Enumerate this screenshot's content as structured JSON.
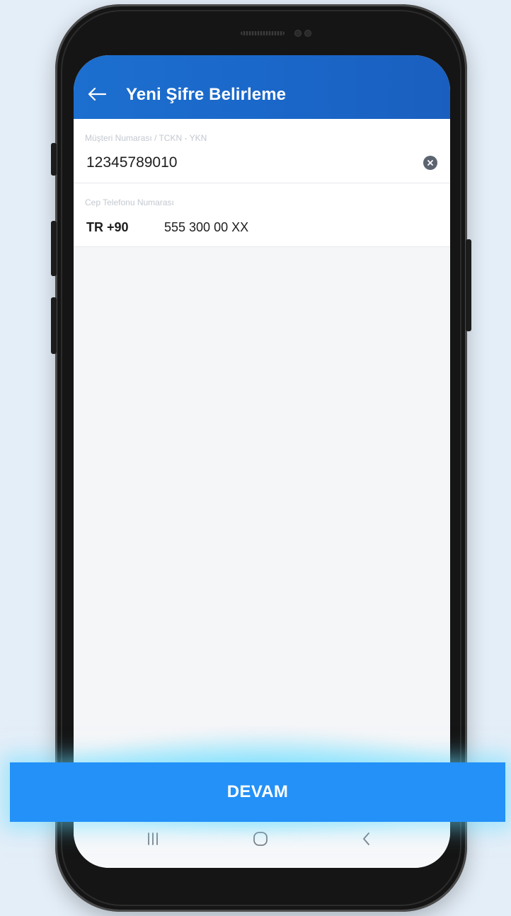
{
  "header": {
    "title": "Yeni Şifre Belirleme",
    "back_icon": "arrow-left-icon"
  },
  "customer_field": {
    "label": "Müşteri Numarası / TCKN - YKN",
    "value": "12345789010",
    "clear_icon": "clear-circle-icon"
  },
  "phone_field": {
    "label": "Cep Telefonu Numarası",
    "country_prefix": "TR +90",
    "value": "555 300 00 XX"
  },
  "primary_button": {
    "label": "DEVAM"
  },
  "nav_bar": {
    "items": [
      "recent-apps-icon",
      "home-icon",
      "back-chevron-icon"
    ]
  },
  "colors": {
    "header_blue": "#1c6fcf",
    "button_blue": "#2391f7",
    "background": "#e4eef8"
  }
}
